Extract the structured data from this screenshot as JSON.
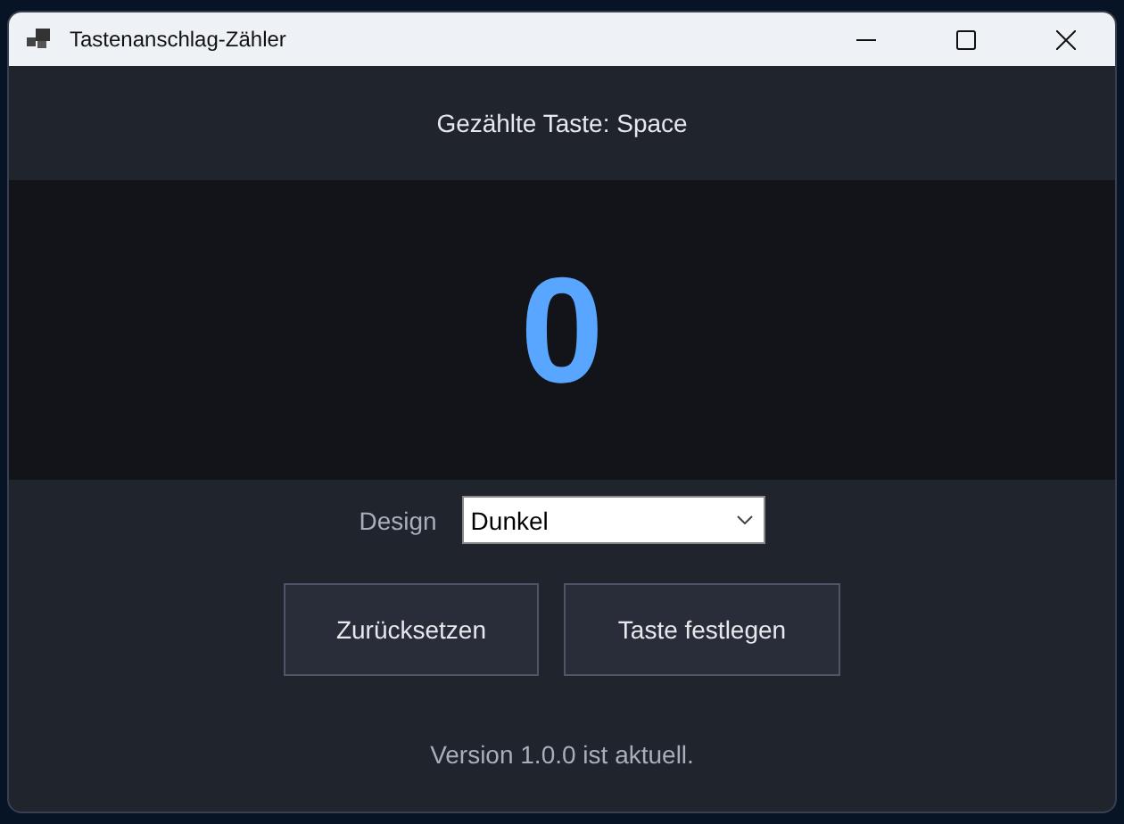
{
  "window": {
    "title": "Tastenanschlag-Zähler"
  },
  "header": {
    "text": "Gezählte Taste: Space"
  },
  "counter": {
    "value": "0"
  },
  "design": {
    "label": "Design",
    "value": "Dunkel"
  },
  "buttons": [
    {
      "label": "Zurücksetzen"
    },
    {
      "label": "Taste festlegen"
    }
  ],
  "status": "Version 1.0.0 ist aktuell."
}
